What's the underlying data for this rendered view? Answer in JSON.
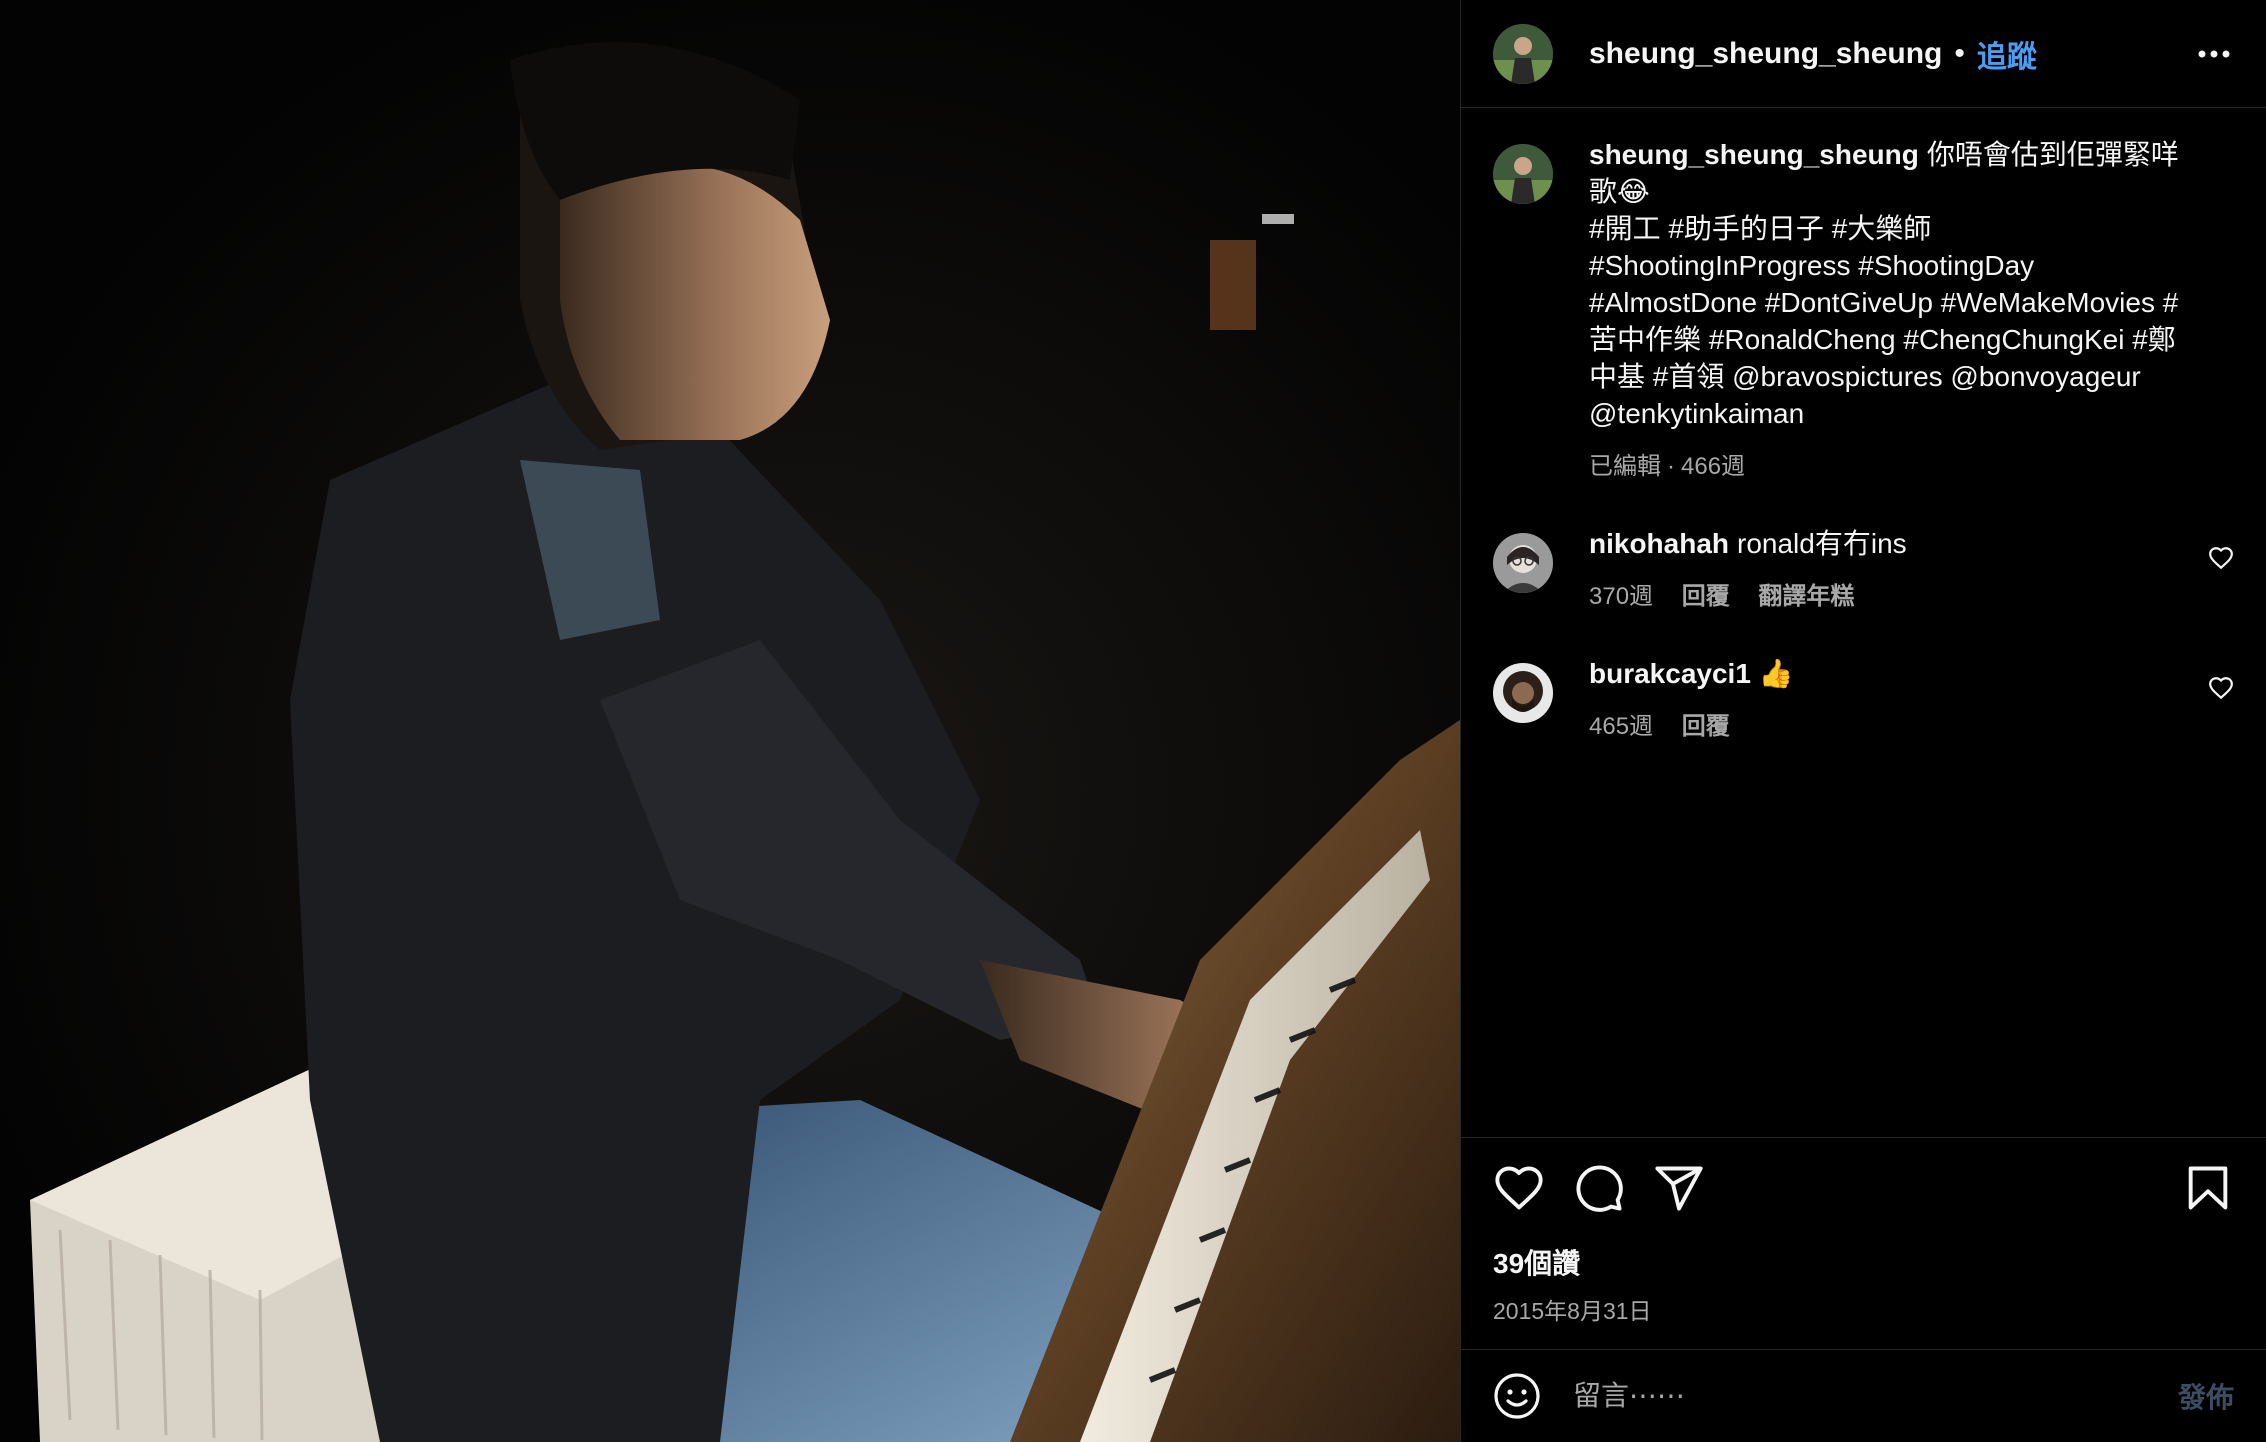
{
  "post": {
    "author": "sheung_sheung_sheung",
    "follow_label": "追蹤",
    "separator": "•"
  },
  "caption": {
    "username": "sheung_sheung_sheung",
    "text": "你唔會估到佢彈緊咩歌😂\n#開工 #助手的日子 #大樂師 #ShootingInProgress #ShootingDay #AlmostDone #DontGiveUp #WeMakeMovies #苦中作樂 #RonaldCheng #ChengChungKei #鄭中基 #首領 @bravospictures @bonvoyageur @tenkytinkaiman",
    "edited_label": "已編輯",
    "meta_sep": "·",
    "age": "466週"
  },
  "comments": [
    {
      "username": "nikohahah",
      "text": "ronald有冇ins",
      "age": "370週",
      "reply_label": "回覆",
      "translate_label": "翻譯年糕"
    },
    {
      "username": "burakcayci1",
      "text": "👍",
      "age": "465週",
      "reply_label": "回覆"
    }
  ],
  "actions": {
    "likes": "39個讚",
    "date": "2015年8月31日"
  },
  "composer": {
    "placeholder": "留言⋯⋯",
    "post_label": "發佈"
  },
  "icons": {
    "more": "more-options-icon",
    "like": "heart-icon",
    "comment": "comment-icon",
    "share": "paper-plane-icon",
    "save": "bookmark-icon",
    "emoji": "emoji-icon"
  },
  "colors": {
    "background": "#000000",
    "link_blue": "#4a9ff5",
    "secondary_text": "#a8a8a8",
    "border": "#262626"
  }
}
